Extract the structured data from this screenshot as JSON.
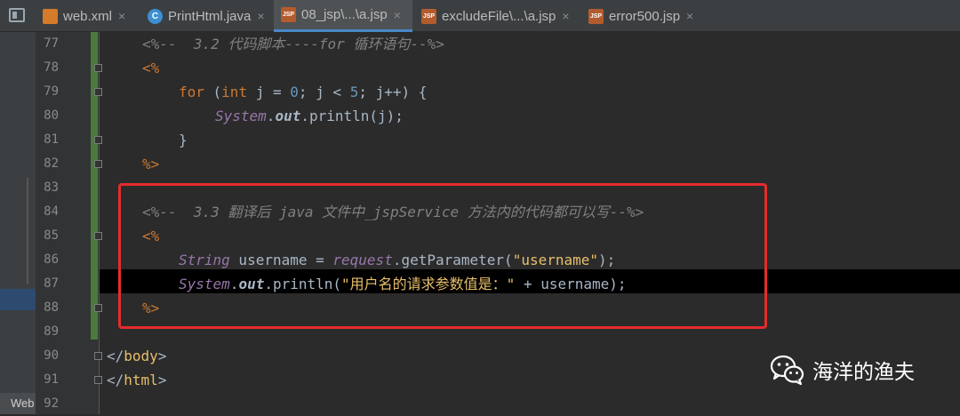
{
  "tabs": [
    {
      "label": "web.xml",
      "icon": "xml-file-icon",
      "icon_text": "",
      "active": false
    },
    {
      "label": "PrintHtml.java",
      "icon": "java-class-icon",
      "icon_text": "C",
      "active": false
    },
    {
      "label": "08_jsp\\...\\a.jsp",
      "icon": "jsp-file-icon",
      "icon_text": "JSP",
      "active": true
    },
    {
      "label": "excludeFile\\...\\a.jsp",
      "icon": "jsp-file-icon",
      "icon_text": "JSP",
      "active": false
    },
    {
      "label": "error500.jsp",
      "icon": "jsp-file-icon",
      "icon_text": "JSP",
      "active": false
    }
  ],
  "close_glyph": "×",
  "line_numbers": [
    "77",
    "78",
    "79",
    "80",
    "81",
    "82",
    "83",
    "84",
    "85",
    "86",
    "87",
    "88",
    "89",
    "90",
    "91",
    "92"
  ],
  "code": {
    "l77": "<%--  3.2 代码脚本----for 循环语句--%>",
    "l78": "<%",
    "l79_for": "for",
    "l79_open": " (",
    "l79_int": "int",
    "l79_j": " j = ",
    "l79_zero": "0",
    "l79_mid": "; j < ",
    "l79_five": "5",
    "l79_end": "; j++) {",
    "l80_sys": "System",
    "l80_dot": ".",
    "l80_out": "out",
    "l80_rest": ".println(j);",
    "l81": "}",
    "l82": "%>",
    "l84": "<%--  3.3 翻译后 java 文件中_jspService 方法内的代码都可以写--%>",
    "l85": "<%",
    "l86_string": "String",
    "l86_var": " username = ",
    "l86_req": "request",
    "l86_call": ".getParameter(",
    "l86_str": "\"username\"",
    "l86_end": ");",
    "l87_sys": "System",
    "l87_dot": ".",
    "l87_out": "out",
    "l87_call": ".println(",
    "l87_str": "\"用户名的请求参数值是：\"",
    "l87_end": " + username);",
    "l88": "%>",
    "l90_open": "</",
    "l90_tag": "body",
    "l90_close": ">",
    "l91_open": "</",
    "l91_tag": "html",
    "l91_close": ">"
  },
  "left_panel_stub": "Web",
  "watermark": {
    "text": "海洋的渔夫",
    "icon": "wechat-icon"
  },
  "colors": {
    "keyword": "#cc7832",
    "comment": "#808080",
    "string": "#e8bf6a",
    "number": "#6897bb",
    "highlight_box": "#e52c2c",
    "active_tab_underline": "#4a88c7"
  }
}
